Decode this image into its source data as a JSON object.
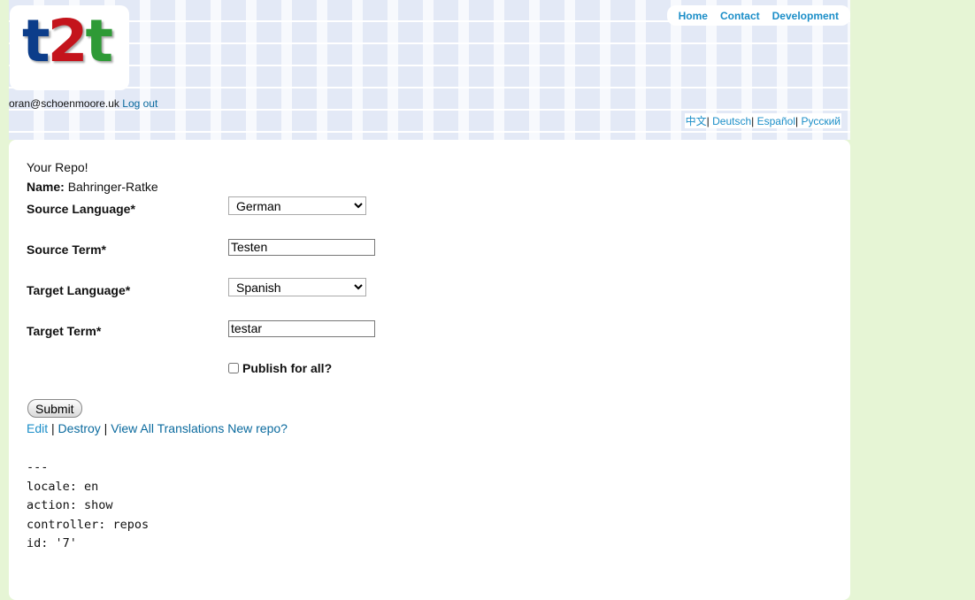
{
  "header": {
    "logo": {
      "letters": [
        "t",
        "2",
        "t"
      ],
      "colors": [
        "#0c3d8a",
        "#c4141c",
        "#2e9a36"
      ]
    },
    "user_email": "oran@schoenmoore.uk",
    "logout_label": "Log out",
    "nav": {
      "home": "Home",
      "contact": "Contact",
      "development": "Development"
    },
    "languages": {
      "chinese": "中文",
      "german": "Deutsch",
      "spanish": "Español",
      "russian": "Русский",
      "separator": "|"
    }
  },
  "repo": {
    "heading": "Your Repo!",
    "name_label": "Name:",
    "name_value": "Bahringer-Ratke",
    "source_language_label": "Source Language*",
    "source_language_value": "German",
    "source_term_label": "Source Term*",
    "source_term_value": "Testen",
    "target_language_label": "Target Language*",
    "target_language_value": "Spanish",
    "target_term_label": "Target Term*",
    "target_term_value": "testar",
    "publish_label": "Publish for all?",
    "publish_checked": false,
    "submit_label": "Submit"
  },
  "actions": {
    "edit": "Edit",
    "destroy": "Destroy",
    "view_all": "View All Translations",
    "new_repo": "New repo?",
    "separator": "|"
  },
  "debug_dump": "---\nlocale: en\naction: show\ncontroller: repos\nid: '7'"
}
